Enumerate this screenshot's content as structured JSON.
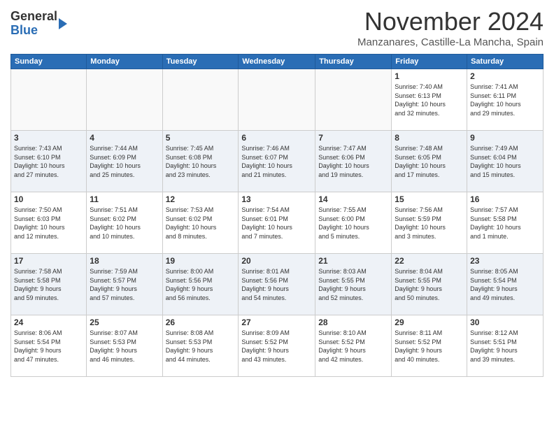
{
  "header": {
    "logo_general": "General",
    "logo_blue": "Blue",
    "month_title": "November 2024",
    "location": "Manzanares, Castille-La Mancha, Spain"
  },
  "weekdays": [
    "Sunday",
    "Monday",
    "Tuesday",
    "Wednesday",
    "Thursday",
    "Friday",
    "Saturday"
  ],
  "weeks": [
    [
      {
        "day": "",
        "info": ""
      },
      {
        "day": "",
        "info": ""
      },
      {
        "day": "",
        "info": ""
      },
      {
        "day": "",
        "info": ""
      },
      {
        "day": "",
        "info": ""
      },
      {
        "day": "1",
        "info": "Sunrise: 7:40 AM\nSunset: 6:13 PM\nDaylight: 10 hours\nand 32 minutes."
      },
      {
        "day": "2",
        "info": "Sunrise: 7:41 AM\nSunset: 6:11 PM\nDaylight: 10 hours\nand 29 minutes."
      }
    ],
    [
      {
        "day": "3",
        "info": "Sunrise: 7:43 AM\nSunset: 6:10 PM\nDaylight: 10 hours\nand 27 minutes."
      },
      {
        "day": "4",
        "info": "Sunrise: 7:44 AM\nSunset: 6:09 PM\nDaylight: 10 hours\nand 25 minutes."
      },
      {
        "day": "5",
        "info": "Sunrise: 7:45 AM\nSunset: 6:08 PM\nDaylight: 10 hours\nand 23 minutes."
      },
      {
        "day": "6",
        "info": "Sunrise: 7:46 AM\nSunset: 6:07 PM\nDaylight: 10 hours\nand 21 minutes."
      },
      {
        "day": "7",
        "info": "Sunrise: 7:47 AM\nSunset: 6:06 PM\nDaylight: 10 hours\nand 19 minutes."
      },
      {
        "day": "8",
        "info": "Sunrise: 7:48 AM\nSunset: 6:05 PM\nDaylight: 10 hours\nand 17 minutes."
      },
      {
        "day": "9",
        "info": "Sunrise: 7:49 AM\nSunset: 6:04 PM\nDaylight: 10 hours\nand 15 minutes."
      }
    ],
    [
      {
        "day": "10",
        "info": "Sunrise: 7:50 AM\nSunset: 6:03 PM\nDaylight: 10 hours\nand 12 minutes."
      },
      {
        "day": "11",
        "info": "Sunrise: 7:51 AM\nSunset: 6:02 PM\nDaylight: 10 hours\nand 10 minutes."
      },
      {
        "day": "12",
        "info": "Sunrise: 7:53 AM\nSunset: 6:02 PM\nDaylight: 10 hours\nand 8 minutes."
      },
      {
        "day": "13",
        "info": "Sunrise: 7:54 AM\nSunset: 6:01 PM\nDaylight: 10 hours\nand 7 minutes."
      },
      {
        "day": "14",
        "info": "Sunrise: 7:55 AM\nSunset: 6:00 PM\nDaylight: 10 hours\nand 5 minutes."
      },
      {
        "day": "15",
        "info": "Sunrise: 7:56 AM\nSunset: 5:59 PM\nDaylight: 10 hours\nand 3 minutes."
      },
      {
        "day": "16",
        "info": "Sunrise: 7:57 AM\nSunset: 5:58 PM\nDaylight: 10 hours\nand 1 minute."
      }
    ],
    [
      {
        "day": "17",
        "info": "Sunrise: 7:58 AM\nSunset: 5:58 PM\nDaylight: 9 hours\nand 59 minutes."
      },
      {
        "day": "18",
        "info": "Sunrise: 7:59 AM\nSunset: 5:57 PM\nDaylight: 9 hours\nand 57 minutes."
      },
      {
        "day": "19",
        "info": "Sunrise: 8:00 AM\nSunset: 5:56 PM\nDaylight: 9 hours\nand 56 minutes."
      },
      {
        "day": "20",
        "info": "Sunrise: 8:01 AM\nSunset: 5:56 PM\nDaylight: 9 hours\nand 54 minutes."
      },
      {
        "day": "21",
        "info": "Sunrise: 8:03 AM\nSunset: 5:55 PM\nDaylight: 9 hours\nand 52 minutes."
      },
      {
        "day": "22",
        "info": "Sunrise: 8:04 AM\nSunset: 5:55 PM\nDaylight: 9 hours\nand 50 minutes."
      },
      {
        "day": "23",
        "info": "Sunrise: 8:05 AM\nSunset: 5:54 PM\nDaylight: 9 hours\nand 49 minutes."
      }
    ],
    [
      {
        "day": "24",
        "info": "Sunrise: 8:06 AM\nSunset: 5:54 PM\nDaylight: 9 hours\nand 47 minutes."
      },
      {
        "day": "25",
        "info": "Sunrise: 8:07 AM\nSunset: 5:53 PM\nDaylight: 9 hours\nand 46 minutes."
      },
      {
        "day": "26",
        "info": "Sunrise: 8:08 AM\nSunset: 5:53 PM\nDaylight: 9 hours\nand 44 minutes."
      },
      {
        "day": "27",
        "info": "Sunrise: 8:09 AM\nSunset: 5:52 PM\nDaylight: 9 hours\nand 43 minutes."
      },
      {
        "day": "28",
        "info": "Sunrise: 8:10 AM\nSunset: 5:52 PM\nDaylight: 9 hours\nand 42 minutes."
      },
      {
        "day": "29",
        "info": "Sunrise: 8:11 AM\nSunset: 5:52 PM\nDaylight: 9 hours\nand 40 minutes."
      },
      {
        "day": "30",
        "info": "Sunrise: 8:12 AM\nSunset: 5:51 PM\nDaylight: 9 hours\nand 39 minutes."
      }
    ]
  ]
}
